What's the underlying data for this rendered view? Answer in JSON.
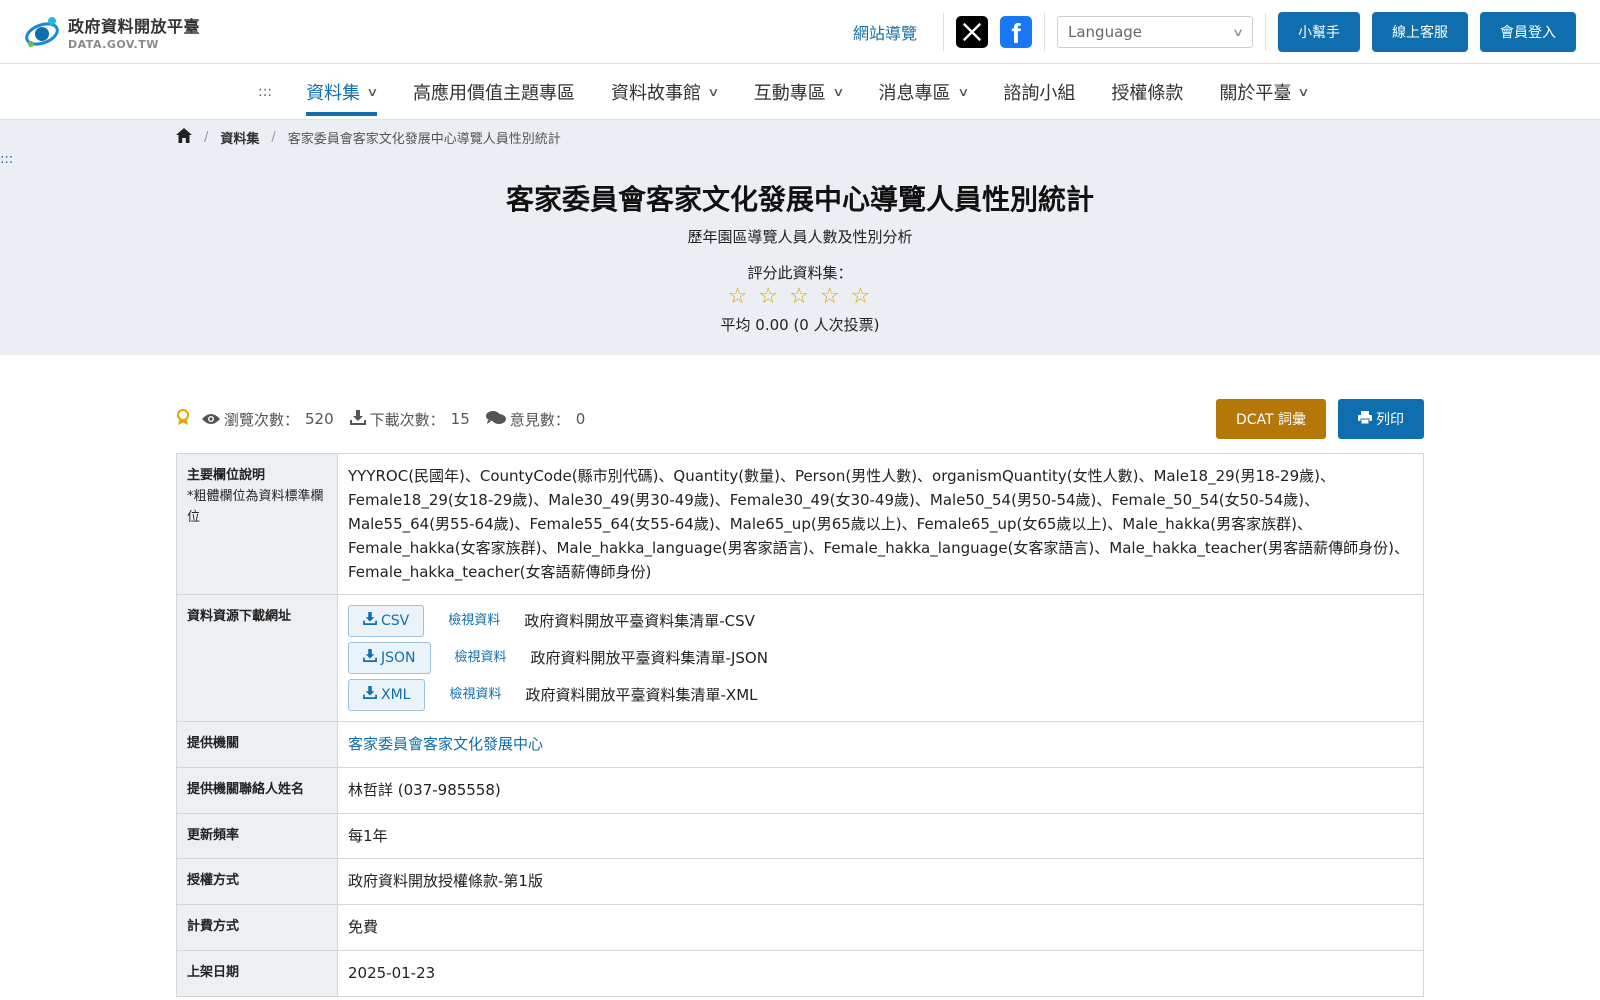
{
  "header": {
    "logo_title": "政府資料開放平臺",
    "logo_sub": "DATA.GOV.TW",
    "sitemap": "網站導覽",
    "x_icon": "x-logo-icon",
    "fb_icon": "facebook-logo-icon",
    "language_placeholder": "Language",
    "buttons": [
      "小幫手",
      "線上客服",
      "會員登入"
    ]
  },
  "nav": {
    "anchor": ":::",
    "items": [
      {
        "label": "資料集",
        "dropdown": true,
        "active": true
      },
      {
        "label": "高應用價值主題專區",
        "dropdown": false
      },
      {
        "label": "資料故事館",
        "dropdown": true
      },
      {
        "label": "互動專區",
        "dropdown": true
      },
      {
        "label": "消息專區",
        "dropdown": true
      },
      {
        "label": "諮詢小組",
        "dropdown": false
      },
      {
        "label": "授權條款",
        "dropdown": false
      },
      {
        "label": "關於平臺",
        "dropdown": true
      }
    ]
  },
  "breadcrumb": {
    "home_icon": "home-icon",
    "level1": "資料集",
    "current": "客家委員會客家文化發展中心導覽人員性別統計"
  },
  "side_anchor": ":::",
  "hero": {
    "title": "客家委員會客家文化發展中心導覽人員性別統計",
    "description": "歷年園區導覽人員人數及性別分析",
    "rate_label": "評分此資料集：",
    "stars_total": 5,
    "stars_filled": 0,
    "average": "平均 0.00 (0 人次投票)"
  },
  "stats": {
    "views_label": "瀏覽次數：",
    "views": "520",
    "downloads_label": "下載次數：",
    "downloads": "15",
    "comments_label": "意見數：",
    "comments": "0",
    "dcat_button": "DCAT 詞彙",
    "print_button": "列印"
  },
  "details": {
    "main_fields_label": "主要欄位說明",
    "main_fields_note": "*粗體欄位為資料標準欄位",
    "main_fields": "YYYROC(民國年)、CountyCode(縣市別代碼)、Quantity(數量)、Person(男性人數)、organismQuantity(女性人數)、Male18_29(男18-29歲)、Female18_29(女18-29歲)、Male30_49(男30-49歲)、Female30_49(女30-49歲)、Male50_54(男50-54歲)、Female_50_54(女50-54歲)、Male55_64(男55-64歲)、Female55_64(女55-64歲)、Male65_up(男65歲以上)、Female65_up(女65歲以上)、Male_hakka(男客家族群)、Female_hakka(女客家族群)、Male_hakka_language(男客家語言)、Female_hakka_language(女客家語言)、Male_hakka_teacher(男客語薪傳師身份)、Female_hakka_teacher(女客語薪傳師身份)",
    "download_label": "資料資源下載網址",
    "resources": [
      {
        "format": "CSV",
        "view": "檢視資料",
        "name": "政府資料開放平臺資料集清單-CSV"
      },
      {
        "format": "JSON",
        "view": "檢視資料",
        "name": "政府資料開放平臺資料集清單-JSON"
      },
      {
        "format": "XML",
        "view": "檢視資料",
        "name": "政府資料開放平臺資料集清單-XML"
      }
    ],
    "provider_label": "提供機關",
    "provider": "客家委員會客家文化發展中心",
    "contact_label": "提供機關聯絡人姓名",
    "contact": "林哲詳 (037-985558)",
    "frequency_label": "更新頻率",
    "frequency": "每1年",
    "license_label": "授權方式",
    "license": "政府資料開放授權條款-第1版",
    "fee_label": "計費方式",
    "fee": "免費",
    "publish_label": "上架日期",
    "publish": "2025-01-23"
  }
}
